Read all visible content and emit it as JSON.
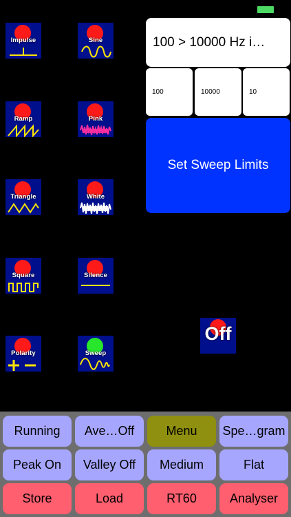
{
  "generators": [
    {
      "id": "impulse",
      "label": "Impulse",
      "active": false,
      "wave_icon": "impulse-icon"
    },
    {
      "id": "sine",
      "label": "Sine",
      "active": false,
      "wave_icon": "sine-wave-icon"
    },
    {
      "id": "ramp",
      "label": "Ramp",
      "active": false,
      "wave_icon": "ramp-wave-icon"
    },
    {
      "id": "pink",
      "label": "Pink",
      "active": false,
      "wave_icon": "pink-noise-icon"
    },
    {
      "id": "triangle",
      "label": "Triangle",
      "active": false,
      "wave_icon": "triangle-wave-icon"
    },
    {
      "id": "white",
      "label": "White",
      "active": false,
      "wave_icon": "white-noise-icon"
    },
    {
      "id": "square",
      "label": "Square",
      "active": false,
      "wave_icon": "square-wave-icon"
    },
    {
      "id": "silence",
      "label": "Silence",
      "active": false,
      "wave_icon": "silence-icon"
    },
    {
      "id": "polarity",
      "label": "Polarity",
      "active": false,
      "wave_icon": "polarity-icon"
    },
    {
      "id": "sweep",
      "label": "Sweep",
      "active": true,
      "wave_icon": "sweep-wave-icon"
    }
  ],
  "sweep": {
    "readout": "100 > 10000 Hz i…",
    "start_hz": "100",
    "end_hz": "10000",
    "duration": "10",
    "set_label": "Set Sweep Limits"
  },
  "output_toggle": {
    "label": "Off"
  },
  "controls": {
    "row1": [
      "Running",
      "Ave…Off",
      "Menu",
      "Spe…gram"
    ],
    "row2": [
      "Peak On",
      "Valley Off",
      "Medium",
      "Flat"
    ],
    "row3": [
      "Store",
      "Load",
      "RT60",
      "Analyser"
    ]
  },
  "colors": {
    "generator_bg": "#000f8c",
    "led_off": "#ff1a1a",
    "led_on": "#27e62c",
    "sweep_button": "#0033ff",
    "button_blue": "#a6a6ff",
    "button_menu": "#8f8f10",
    "button_red": "#ff5f6f"
  }
}
